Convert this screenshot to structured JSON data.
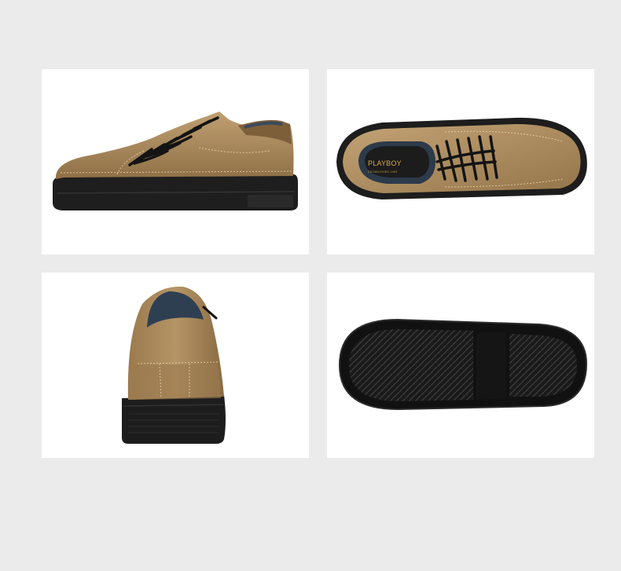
{
  "gallery": {
    "background_color": "#ebebeb",
    "panel_color": "#ffffff",
    "leather_color": "#a8875a",
    "sole_color": "#1c1c1c",
    "views": [
      {
        "name": "side-view"
      },
      {
        "name": "top-view"
      },
      {
        "name": "back-view"
      },
      {
        "name": "sole-view"
      }
    ],
    "insole_logo": {
      "brand": "PLAYBOY",
      "tagline": "ESTABLISHED 1953"
    }
  }
}
